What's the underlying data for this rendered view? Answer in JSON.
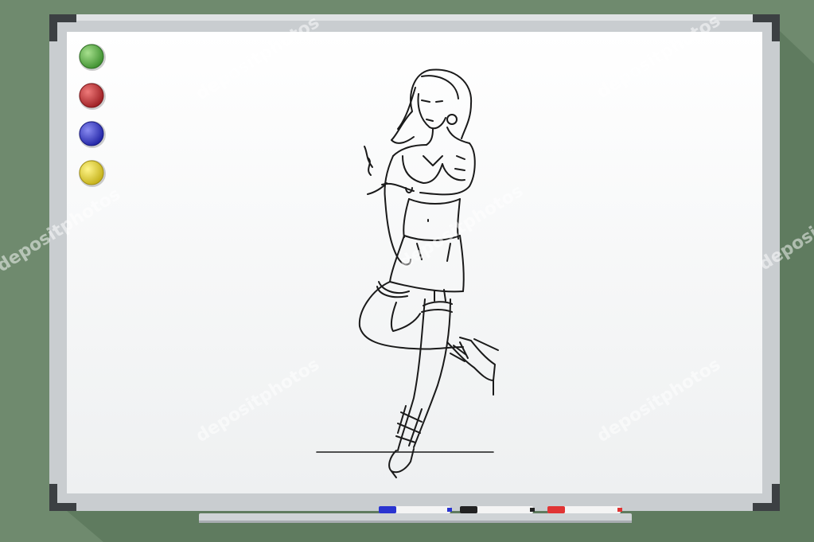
{
  "background_color": "#6f8a6e",
  "shadow_color": "#5e7a5e",
  "frame_color": "#c7cbce",
  "board_color": "#f3f4f5",
  "corner_color": "#3e4244",
  "magnets": [
    {
      "name": "green",
      "color": "#4caf3a"
    },
    {
      "name": "red",
      "color": "#c0262b"
    },
    {
      "name": "blue",
      "color": "#2c2fc4"
    },
    {
      "name": "yellow",
      "color": "#e3d21e"
    }
  ],
  "markers": [
    {
      "name": "blue",
      "color": "#2a34d0"
    },
    {
      "name": "black",
      "color": "#222222"
    },
    {
      "name": "red",
      "color": "#e03434"
    }
  ],
  "watermark": "depositphotos",
  "drawing": {
    "subject": "ink sketch of a woman in stockings and high heels standing on one leg, holding a cigarette",
    "ink_color": "#1a1a1a"
  }
}
